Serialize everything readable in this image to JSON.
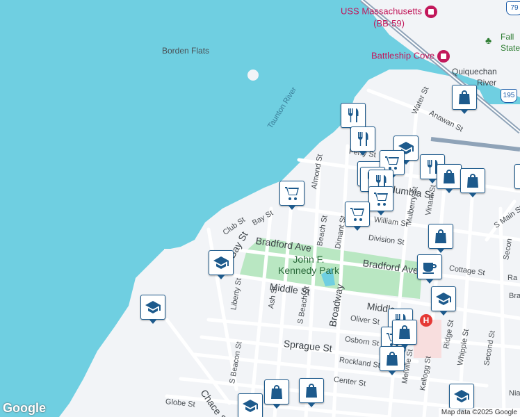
{
  "map": {
    "colors": {
      "water": "#6fcfe1",
      "land": "#f2f4f7",
      "road": "#ffffff",
      "park": "#b9e7c2",
      "pin_border": "#1d5a8c",
      "pin_icon": "#1d5a8c",
      "poi": "#c2185b",
      "highway": "#8fa3b8"
    },
    "labels": {
      "uss_1": "USS Massachusetts",
      "uss_2": "(BB-59)",
      "battleship": "Battleship Cove",
      "borden": "Borden Flats",
      "taunton": "Taunton River",
      "quiquechan_1": "Quiquechan",
      "quiquechan_2": "River",
      "fall_1": "Fall",
      "fall_2": "State",
      "route_79": "79",
      "route_195": "195",
      "park_1": "John F.",
      "park_2": "Kennedy Park",
      "water_st": "Water St",
      "anawan_st": "Anawan St",
      "almond_st": "Almond St",
      "columbia_st": "Columbia St",
      "ferry_st": "Ferry St",
      "bay_st": "Bay St",
      "club_st": "Club St",
      "bradford_ave_w": "Bradford Ave",
      "bradford_ave_e": "Bradford Ave",
      "bay_st_2": "Bay St",
      "beach_st": "Beach St",
      "dimant_st": "Dimant St",
      "william_st": "William St",
      "division_st": "Division St",
      "mulberry_st": "Mulberry St",
      "vine_st": "Vinant St",
      "cottage_st": "Cottage St",
      "middle_st_w": "Middle St",
      "middle_st_e": "Middle",
      "liberty_st": "Liberty St",
      "ash_st": "Ash St",
      "s_beach_st": "S Beach St",
      "broadway": "Broadway",
      "oliver_st": "Oliver St",
      "osborn_st": "Osborn St",
      "sprague_st": "Sprague St",
      "rockland_st": "Rockland St",
      "center_st": "Center St",
      "melville_st": "Melville St",
      "kellogg_st": "Kellogg St",
      "ridge_st": "Ridge St",
      "whipple_st": "Whipple St",
      "second_st": "Second St",
      "s_main_st": "S Main St",
      "s_beacon_st": "S Beacon St",
      "chace_st": "Chace St",
      "globe_st": "Globe St",
      "ra_st": "Ra",
      "bra_st": "Bra",
      "secon_st": "Secon",
      "nia_st": "Nia"
    },
    "pins": [
      {
        "name": "restaurant-marker",
        "icon": "restaurant"
      },
      {
        "name": "restaurant-marker",
        "icon": "restaurant"
      },
      {
        "name": "shopping-bag-marker",
        "icon": "bag"
      },
      {
        "name": "school-marker",
        "icon": "school"
      },
      {
        "name": "grocery-marker",
        "icon": "cart"
      },
      {
        "name": "grocery-marker",
        "icon": "cart"
      },
      {
        "name": "restaurant-marker",
        "icon": "restaurant"
      },
      {
        "name": "restaurant-marker",
        "icon": "restaurant"
      },
      {
        "name": "grocery-marker",
        "icon": "cart"
      },
      {
        "name": "grocery-marker",
        "icon": "cart"
      },
      {
        "name": "restaurant-marker",
        "icon": "restaurant"
      },
      {
        "name": "shopping-bag-marker",
        "icon": "bag"
      },
      {
        "name": "shopping-bag-marker",
        "icon": "bag"
      },
      {
        "name": "grocery-marker",
        "icon": "cart"
      },
      {
        "name": "shopping-bag-marker",
        "icon": "bag"
      },
      {
        "name": "coffee-marker",
        "icon": "coffee"
      },
      {
        "name": "school-marker",
        "icon": "school"
      },
      {
        "name": "school-marker",
        "icon": "school"
      },
      {
        "name": "school-marker",
        "icon": "school"
      },
      {
        "name": "shopping-bag-marker",
        "icon": "bag"
      },
      {
        "name": "restaurant-marker",
        "icon": "restaurant"
      },
      {
        "name": "grocery-marker",
        "icon": "cart"
      },
      {
        "name": "shopping-bag-marker",
        "icon": "bag"
      },
      {
        "name": "shopping-bag-marker",
        "icon": "bag"
      },
      {
        "name": "shopping-bag-marker",
        "icon": "bag"
      },
      {
        "name": "school-marker",
        "icon": "school"
      },
      {
        "name": "school-marker",
        "icon": "school"
      },
      {
        "name": "shopping-bag-marker",
        "icon": "bag"
      }
    ],
    "hospital": "H",
    "google": "Google",
    "attribution": "Map data ©2025 Google"
  }
}
